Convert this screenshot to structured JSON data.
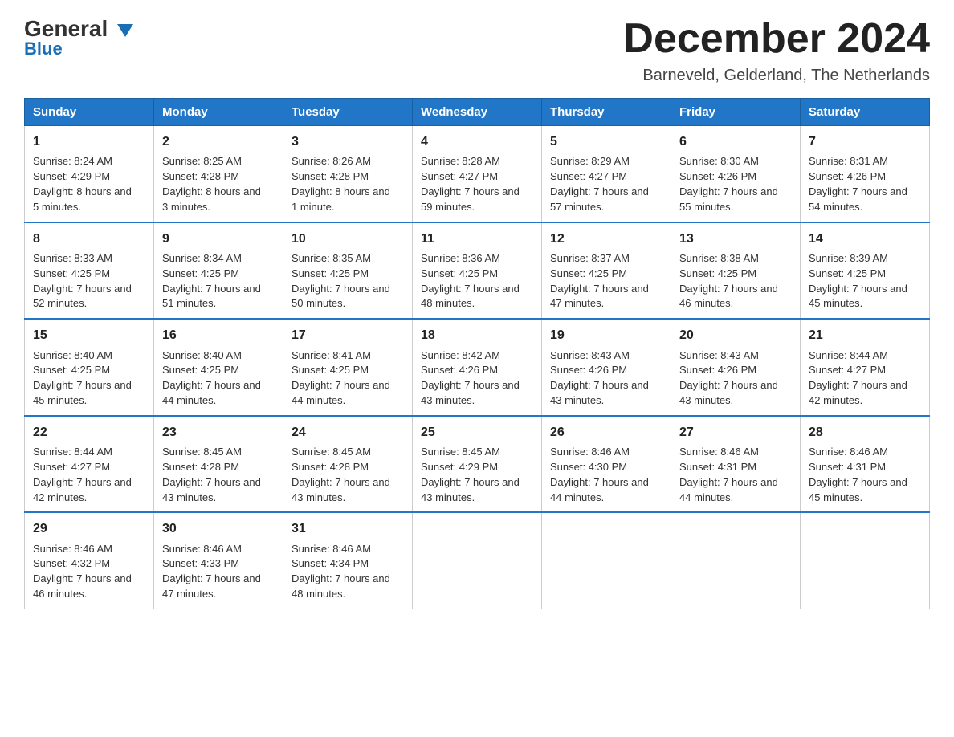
{
  "logo": {
    "text_general": "General",
    "text_blue": "Blue",
    "arrow": "▼"
  },
  "header": {
    "title": "December 2024",
    "subtitle": "Barneveld, Gelderland, The Netherlands"
  },
  "days_of_week": [
    "Sunday",
    "Monday",
    "Tuesday",
    "Wednesday",
    "Thursday",
    "Friday",
    "Saturday"
  ],
  "weeks": [
    [
      {
        "day": "1",
        "sunrise": "8:24 AM",
        "sunset": "4:29 PM",
        "daylight": "8 hours and 5 minutes."
      },
      {
        "day": "2",
        "sunrise": "8:25 AM",
        "sunset": "4:28 PM",
        "daylight": "8 hours and 3 minutes."
      },
      {
        "day": "3",
        "sunrise": "8:26 AM",
        "sunset": "4:28 PM",
        "daylight": "8 hours and 1 minute."
      },
      {
        "day": "4",
        "sunrise": "8:28 AM",
        "sunset": "4:27 PM",
        "daylight": "7 hours and 59 minutes."
      },
      {
        "day": "5",
        "sunrise": "8:29 AM",
        "sunset": "4:27 PM",
        "daylight": "7 hours and 57 minutes."
      },
      {
        "day": "6",
        "sunrise": "8:30 AM",
        "sunset": "4:26 PM",
        "daylight": "7 hours and 55 minutes."
      },
      {
        "day": "7",
        "sunrise": "8:31 AM",
        "sunset": "4:26 PM",
        "daylight": "7 hours and 54 minutes."
      }
    ],
    [
      {
        "day": "8",
        "sunrise": "8:33 AM",
        "sunset": "4:25 PM",
        "daylight": "7 hours and 52 minutes."
      },
      {
        "day": "9",
        "sunrise": "8:34 AM",
        "sunset": "4:25 PM",
        "daylight": "7 hours and 51 minutes."
      },
      {
        "day": "10",
        "sunrise": "8:35 AM",
        "sunset": "4:25 PM",
        "daylight": "7 hours and 50 minutes."
      },
      {
        "day": "11",
        "sunrise": "8:36 AM",
        "sunset": "4:25 PM",
        "daylight": "7 hours and 48 minutes."
      },
      {
        "day": "12",
        "sunrise": "8:37 AM",
        "sunset": "4:25 PM",
        "daylight": "7 hours and 47 minutes."
      },
      {
        "day": "13",
        "sunrise": "8:38 AM",
        "sunset": "4:25 PM",
        "daylight": "7 hours and 46 minutes."
      },
      {
        "day": "14",
        "sunrise": "8:39 AM",
        "sunset": "4:25 PM",
        "daylight": "7 hours and 45 minutes."
      }
    ],
    [
      {
        "day": "15",
        "sunrise": "8:40 AM",
        "sunset": "4:25 PM",
        "daylight": "7 hours and 45 minutes."
      },
      {
        "day": "16",
        "sunrise": "8:40 AM",
        "sunset": "4:25 PM",
        "daylight": "7 hours and 44 minutes."
      },
      {
        "day": "17",
        "sunrise": "8:41 AM",
        "sunset": "4:25 PM",
        "daylight": "7 hours and 44 minutes."
      },
      {
        "day": "18",
        "sunrise": "8:42 AM",
        "sunset": "4:26 PM",
        "daylight": "7 hours and 43 minutes."
      },
      {
        "day": "19",
        "sunrise": "8:43 AM",
        "sunset": "4:26 PM",
        "daylight": "7 hours and 43 minutes."
      },
      {
        "day": "20",
        "sunrise": "8:43 AM",
        "sunset": "4:26 PM",
        "daylight": "7 hours and 43 minutes."
      },
      {
        "day": "21",
        "sunrise": "8:44 AM",
        "sunset": "4:27 PM",
        "daylight": "7 hours and 42 minutes."
      }
    ],
    [
      {
        "day": "22",
        "sunrise": "8:44 AM",
        "sunset": "4:27 PM",
        "daylight": "7 hours and 42 minutes."
      },
      {
        "day": "23",
        "sunrise": "8:45 AM",
        "sunset": "4:28 PM",
        "daylight": "7 hours and 43 minutes."
      },
      {
        "day": "24",
        "sunrise": "8:45 AM",
        "sunset": "4:28 PM",
        "daylight": "7 hours and 43 minutes."
      },
      {
        "day": "25",
        "sunrise": "8:45 AM",
        "sunset": "4:29 PM",
        "daylight": "7 hours and 43 minutes."
      },
      {
        "day": "26",
        "sunrise": "8:46 AM",
        "sunset": "4:30 PM",
        "daylight": "7 hours and 44 minutes."
      },
      {
        "day": "27",
        "sunrise": "8:46 AM",
        "sunset": "4:31 PM",
        "daylight": "7 hours and 44 minutes."
      },
      {
        "day": "28",
        "sunrise": "8:46 AM",
        "sunset": "4:31 PM",
        "daylight": "7 hours and 45 minutes."
      }
    ],
    [
      {
        "day": "29",
        "sunrise": "8:46 AM",
        "sunset": "4:32 PM",
        "daylight": "7 hours and 46 minutes."
      },
      {
        "day": "30",
        "sunrise": "8:46 AM",
        "sunset": "4:33 PM",
        "daylight": "7 hours and 47 minutes."
      },
      {
        "day": "31",
        "sunrise": "8:46 AM",
        "sunset": "4:34 PM",
        "daylight": "7 hours and 48 minutes."
      },
      null,
      null,
      null,
      null
    ]
  ]
}
